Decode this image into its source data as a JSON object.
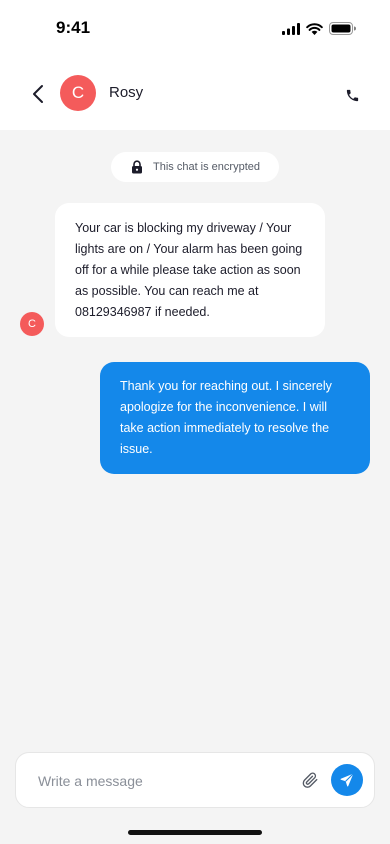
{
  "status_bar": {
    "time": "9:41",
    "icons": [
      "cellular-signal-icon",
      "wifi-icon",
      "battery-icon"
    ]
  },
  "header": {
    "back_icon": "chevron-left-icon",
    "avatar_initial": "C",
    "avatar_color": "#f45b5b",
    "contact_name": "Rosy",
    "call_icon": "phone-icon"
  },
  "chat": {
    "encryption_notice": "This chat is encrypted",
    "lock_icon": "lock-icon",
    "messages": [
      {
        "direction": "incoming",
        "sender_initial": "C",
        "text": "Your car is blocking my driveway / Your lights are on / Your alarm has been going off for a while please take action as soon as possible. You can reach me at 08129346987 if needed."
      },
      {
        "direction": "outgoing",
        "text": "Thank you for reaching out. I sincerely apologize for the inconvenience. I will take action immediately to resolve the issue."
      }
    ]
  },
  "composer": {
    "placeholder": "Write a message",
    "value": "",
    "attach_icon": "paperclip-icon",
    "send_icon": "send-icon"
  },
  "colors": {
    "accent": "#1488ea",
    "background": "#f4f4f4",
    "avatar": "#f45b5b"
  }
}
